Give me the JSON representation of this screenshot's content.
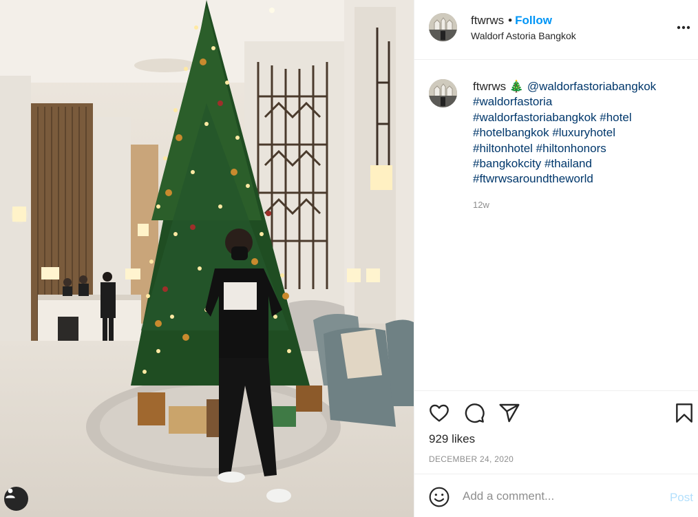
{
  "post": {
    "username": "ftwrws",
    "separator": "•",
    "follow_label": "Follow",
    "location": "Waldorf Astoria Bangkok",
    "more_icon": "more-horizontal-icon",
    "caption": {
      "username": "ftwrws",
      "emoji": "🎄",
      "lines": [
        "@waldorfastoriabangkok",
        "#waldorfastoria",
        "#waldorfastoriabangkok #hotel",
        "#hotelbangkok #luxuryhotel",
        "#hiltonhotel #hiltonhonors",
        "#bangkokcity #thailand",
        "#ftwrwsaroundtheworld"
      ],
      "time_ago": "12w"
    },
    "likes": "929 likes",
    "date": "DECEMBER 24, 2020",
    "comment": {
      "placeholder": "Add a comment...",
      "post_label": "Post"
    }
  },
  "colors": {
    "link": "#00376b",
    "follow": "#0095f6",
    "muted": "#8e8e8e",
    "post_disabled": "#b2dffc",
    "divider": "#efefef"
  },
  "icons": [
    "heart-icon",
    "comment-icon",
    "share-icon",
    "bookmark-icon",
    "emoji-icon",
    "user-tag-icon"
  ]
}
